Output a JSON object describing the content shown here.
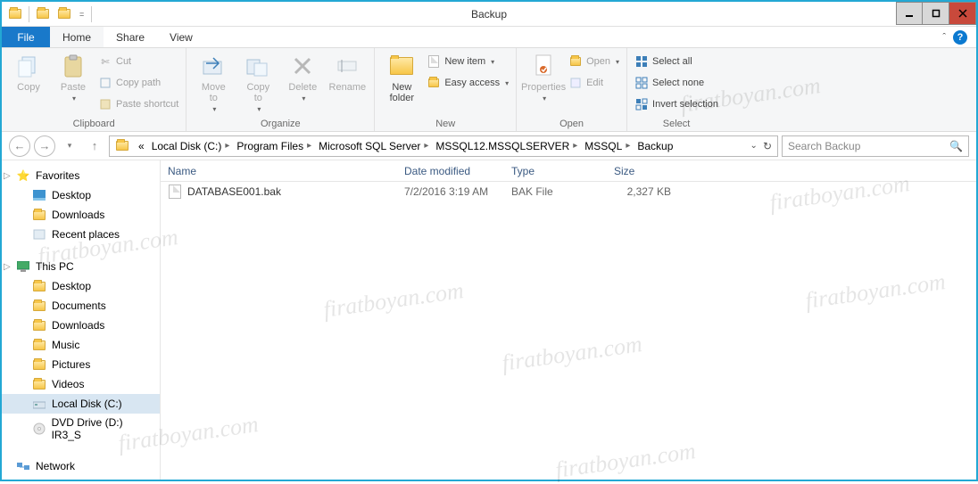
{
  "window": {
    "title": "Backup"
  },
  "menu": {
    "file": "File",
    "tabs": [
      "Home",
      "Share",
      "View"
    ],
    "active": 0
  },
  "ribbon": {
    "clipboard": {
      "label": "Clipboard",
      "copy": "Copy",
      "paste": "Paste",
      "cut": "Cut",
      "copypath": "Copy path",
      "pasteshortcut": "Paste shortcut"
    },
    "organize": {
      "label": "Organize",
      "moveto": "Move\nto",
      "copyto": "Copy\nto",
      "delete": "Delete",
      "rename": "Rename"
    },
    "new": {
      "label": "New",
      "newfolder": "New\nfolder",
      "newitem": "New item",
      "easyaccess": "Easy access"
    },
    "open": {
      "label": "Open",
      "properties": "Properties",
      "open": "Open",
      "edit": "Edit"
    },
    "select": {
      "label": "Select",
      "selectall": "Select all",
      "selectnone": "Select none",
      "invert": "Invert selection"
    }
  },
  "breadcrumb": {
    "parts": [
      "Local Disk (C:)",
      "Program Files",
      "Microsoft SQL Server",
      "MSSQL12.MSSQLSERVER",
      "MSSQL",
      "Backup"
    ],
    "prefix": "«"
  },
  "search": {
    "placeholder": "Search Backup"
  },
  "nav": {
    "favorites": {
      "label": "Favorites",
      "items": [
        "Desktop",
        "Downloads",
        "Recent places"
      ]
    },
    "thispc": {
      "label": "This PC",
      "items": [
        "Desktop",
        "Documents",
        "Downloads",
        "Music",
        "Pictures",
        "Videos",
        "Local Disk (C:)",
        "DVD Drive (D:) IR3_S"
      ]
    },
    "network": {
      "label": "Network"
    }
  },
  "columns": {
    "name": "Name",
    "date": "Date modified",
    "type": "Type",
    "size": "Size"
  },
  "files": [
    {
      "name": "DATABASE001.bak",
      "date": "7/2/2016 3:19 AM",
      "type": "BAK File",
      "size": "2,327 KB"
    }
  ],
  "watermark": "firatboyan.com"
}
